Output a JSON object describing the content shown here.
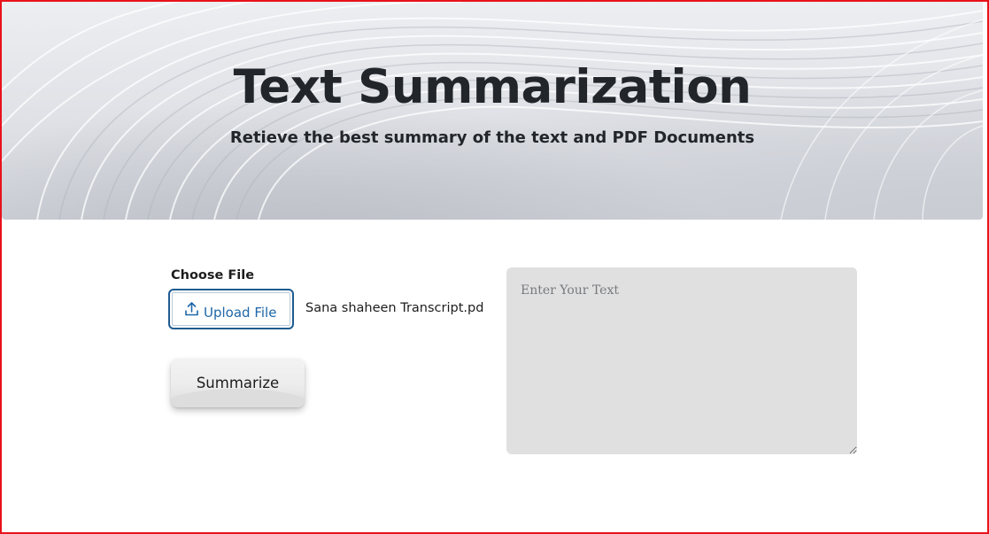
{
  "hero": {
    "title": "Text Summarization",
    "subtitle": "Retieve the best summary of the text and PDF Documents"
  },
  "file_picker": {
    "label": "Choose File",
    "button_label": "Upload File",
    "button_icon": "upload-icon",
    "selected_file": "Sana shaheen Transcript.pd"
  },
  "actions": {
    "summarize_label": "Summarize"
  },
  "text_input": {
    "placeholder": "Enter Your Text",
    "value": ""
  },
  "colors": {
    "frame_border": "#e8121b",
    "title_text": "#22262b",
    "upload_border": "#1f5b90",
    "upload_text": "#1f67a8",
    "textarea_bg": "#e0e0e0"
  }
}
